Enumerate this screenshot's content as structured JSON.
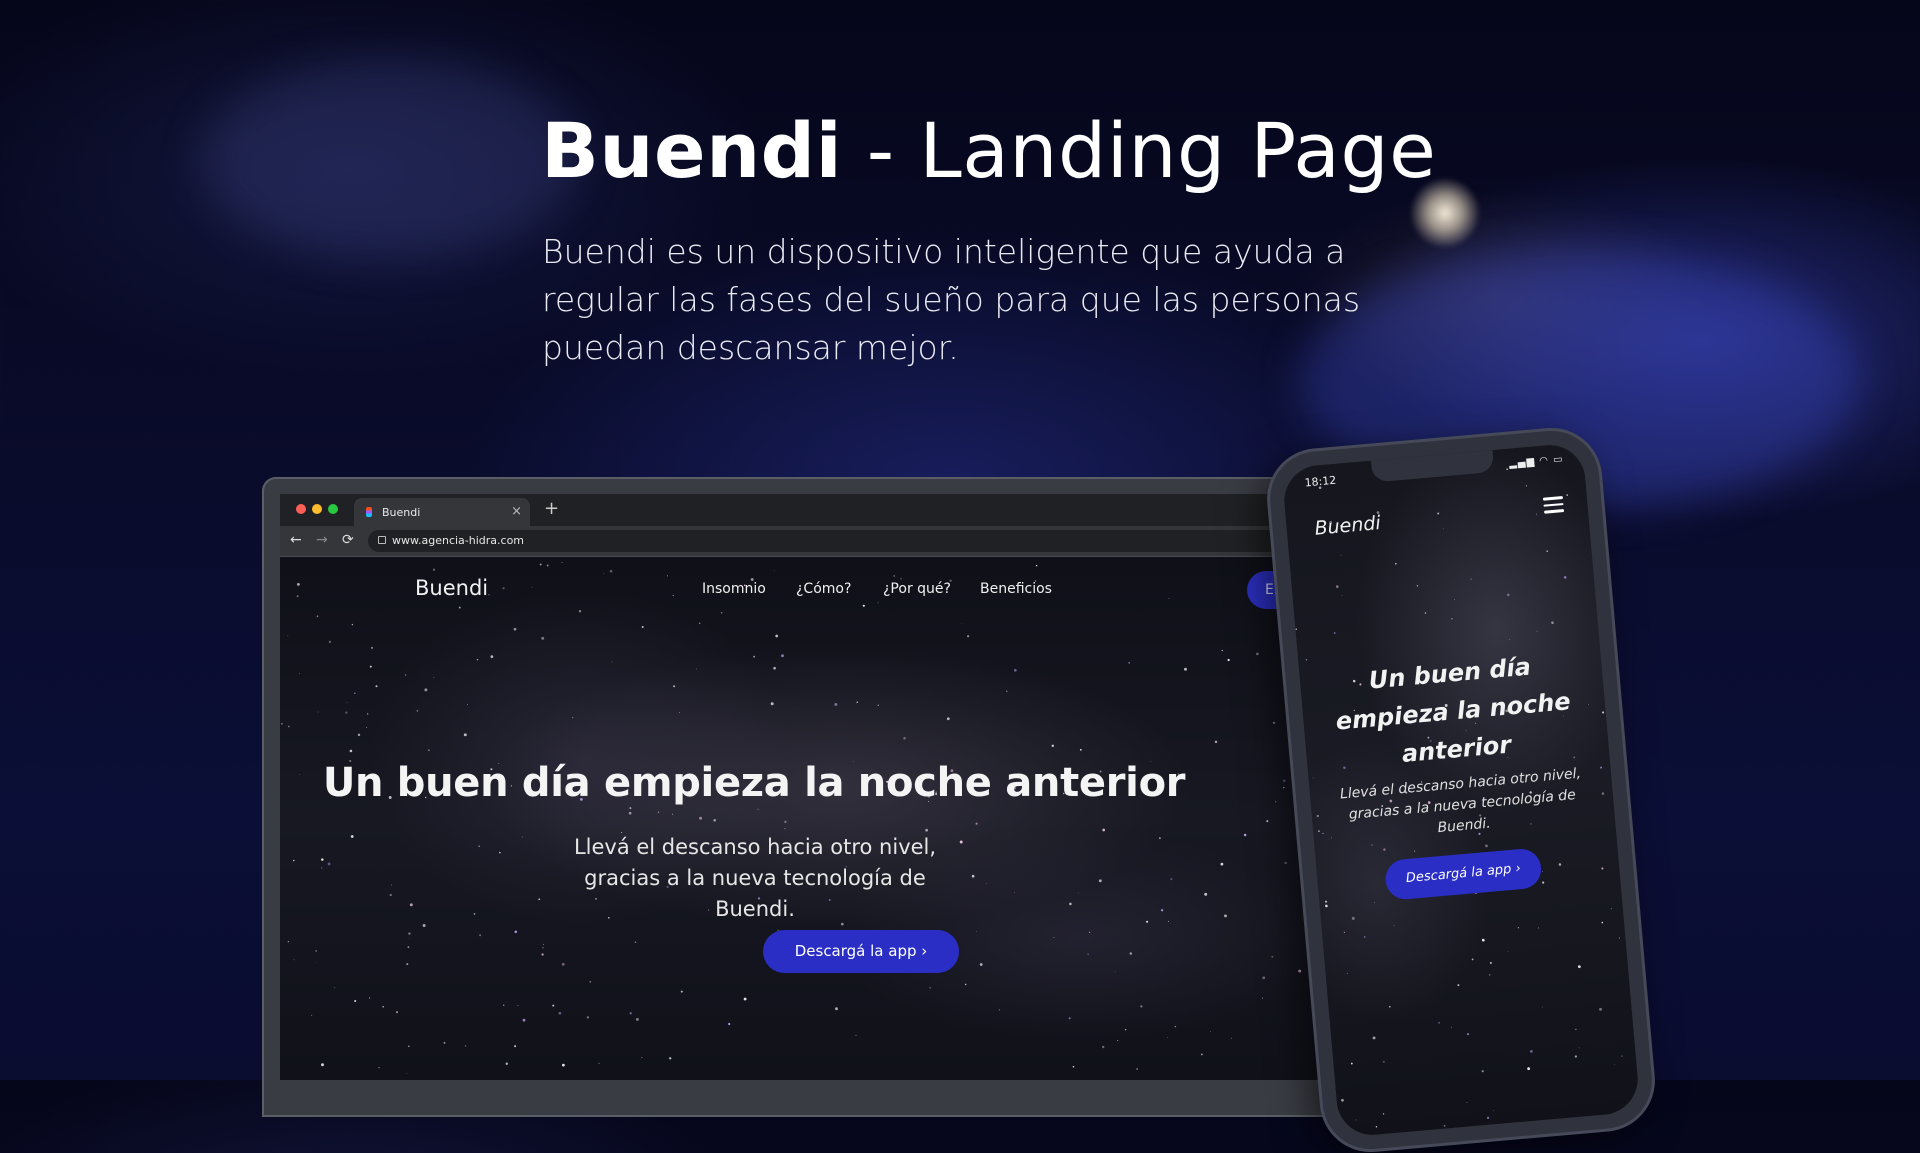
{
  "presentation": {
    "title_bold": "Buendi",
    "title_rest": " - Landing Page",
    "description": "Buendi es un dispositivo inteligente que ayuda a regular las fases del sueño para que las personas puedan descansar mejor."
  },
  "browser": {
    "tab_title": "Buendi",
    "tab_close": "×",
    "new_tab": "+",
    "url": "www.agencia-hidra.com",
    "back": "←",
    "forward": "→",
    "reload": "⟳"
  },
  "site": {
    "logo": "Buendi",
    "nav": [
      "Insomnio",
      "¿Cómo?",
      "¿Por qué?",
      "Beneficios"
    ],
    "enter_button": "Entrar",
    "hero_title": "Un buen día empieza la noche anterior",
    "hero_subtitle": "Llevá el descanso hacia otro nivel, gracias a la nueva tecnología de Buendi.",
    "cta": "Descargá la app  ›"
  },
  "phone": {
    "time": "18:12",
    "status_icons": "▂▄▆ ◠ ▭",
    "logo": "Buendi",
    "hero_title": "Un buen día empieza la noche anterior",
    "hero_subtitle": "Llevá el descanso hacia otro nivel, gracias a la nueva tecnología de Buendi.",
    "cta": "Descargá la app  ›"
  },
  "colors": {
    "accent": "#2b2fc0",
    "background": "#0a0c2c"
  }
}
